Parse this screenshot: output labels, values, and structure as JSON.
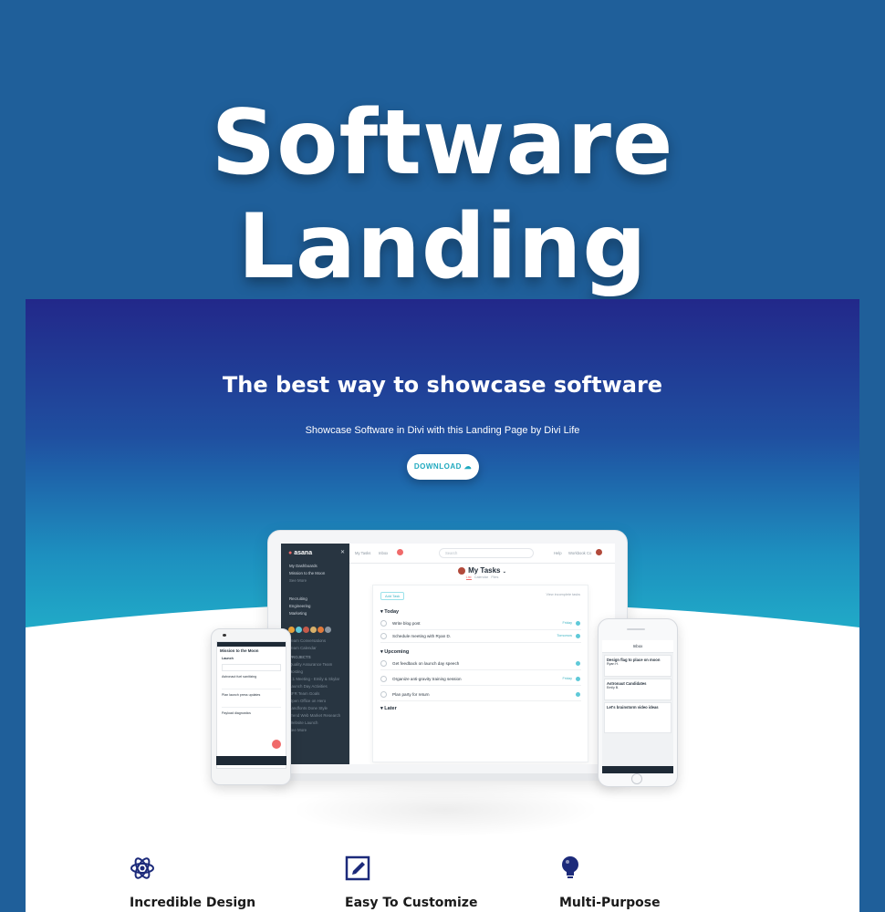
{
  "banner": {
    "title": "Software Landing"
  },
  "hero": {
    "title": "The best way to showcase software",
    "subtitle": "Showcase Software in Divi with this Landing Page by Divi Life",
    "download_label": "DOWNLOAD"
  },
  "app": {
    "logo": "asana",
    "sidebar": {
      "items": [
        "My Dashboards",
        "Mission to the Moon",
        "See More",
        "Recruiting",
        "Engineering",
        "Marketing",
        "Team Conversations",
        "Team Calendar",
        "PROJECTS",
        "Quality Assurance Team",
        "Hosting",
        "1:1 Meeting - Emily & Skylar",
        "Launch Day Activities",
        "SFR Team Goals",
        "Open Office on Hero",
        "Landfonts Done Style",
        "Trend Web Market Research",
        "Website Launch",
        "See More"
      ]
    },
    "topbar": {
      "my_tasks": "My Tasks",
      "inbox": "Inbox",
      "search": "Search",
      "help": "Help",
      "user": "Workbook Co"
    },
    "page_title": "My Tasks",
    "subtabs": [
      "List",
      "Calendar",
      "Files"
    ],
    "add_task": "Add Task",
    "incomplete": "View incomplete tasks",
    "sections": {
      "today": "Today",
      "upcoming": "Upcoming",
      "later": "Later"
    },
    "today_tasks": [
      {
        "text": "Write blog post",
        "tag": "Friday"
      },
      {
        "text": "Schedule meeting with Ryan D.",
        "tag": "Tomorrow"
      }
    ],
    "upcoming_tasks": [
      {
        "text": "Get feedback on launch day speech",
        "tag": ""
      },
      {
        "text": "Organize anti-gravity training session",
        "tag": "Friday"
      },
      {
        "text": "Plan party for return",
        "tag": ""
      }
    ]
  },
  "android": {
    "title": "Mission to the Moon",
    "list": "Launch",
    "items": [
      "Astronaut fuel sanitizing",
      "Plan launch press updates",
      "Payload diagnostics"
    ]
  },
  "iphone": {
    "title": "Inbox",
    "cards": [
      {
        "title": "Design flag to place on moon",
        "sub": "Ryan H."
      },
      {
        "title": "Astronaut Candidates",
        "sub": "Emily B."
      },
      {
        "title": "Let's brainstorm video ideas",
        "sub": ""
      }
    ]
  },
  "features": [
    {
      "label": "Incredible Design",
      "icon": "atom-icon"
    },
    {
      "label": "Easy To Customize",
      "icon": "pencil-square-icon"
    },
    {
      "label": "Multi-Purpose",
      "icon": "lightbulb-icon"
    }
  ],
  "colors": {
    "banner_bg": "#1f5f9a",
    "hero_top": "#22288a",
    "hero_bottom": "#23c1cf",
    "accent_red": "#f06a6a",
    "accent_teal": "#1fa9bf",
    "icon_navy": "#1c2a7a"
  }
}
